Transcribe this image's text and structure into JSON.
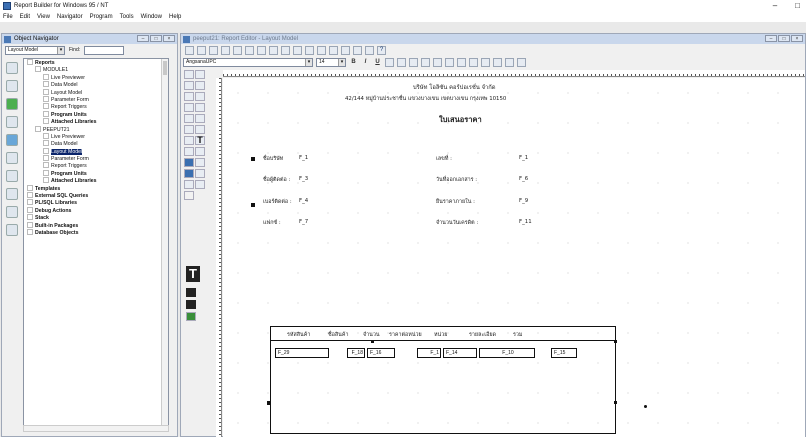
{
  "app": {
    "title": "Report Builder for Windows 95 / NT",
    "window_controls": [
      "–",
      "□"
    ]
  },
  "menu": [
    "File",
    "Edit",
    "View",
    "Navigator",
    "Program",
    "Tools",
    "Window",
    "Help"
  ],
  "navigator": {
    "title": "Object Navigator",
    "view_select": "Layout Model",
    "find_label": "Find:",
    "tree": [
      {
        "label": "Reports",
        "indent": 0,
        "bold": true
      },
      {
        "label": "MODULE1",
        "indent": 1
      },
      {
        "label": "Live Previewer",
        "indent": 2
      },
      {
        "label": "Data Model",
        "indent": 2
      },
      {
        "label": "Layout Model",
        "indent": 2
      },
      {
        "label": "Parameter Form",
        "indent": 2
      },
      {
        "label": "Report Triggers",
        "indent": 2
      },
      {
        "label": "Program Units",
        "indent": 2,
        "bold": true
      },
      {
        "label": "Attached Libraries",
        "indent": 2,
        "bold": true
      },
      {
        "label": "PEEPUT21",
        "indent": 1
      },
      {
        "label": "Live Previewer",
        "indent": 2
      },
      {
        "label": "Data Model",
        "indent": 2
      },
      {
        "label": "Layout Model",
        "indent": 2,
        "selected": true
      },
      {
        "label": "Parameter Form",
        "indent": 2
      },
      {
        "label": "Report Triggers",
        "indent": 2
      },
      {
        "label": "Program Units",
        "indent": 2,
        "bold": true
      },
      {
        "label": "Attached Libraries",
        "indent": 2,
        "bold": true
      },
      {
        "label": "Templates",
        "indent": 0,
        "bold": true
      },
      {
        "label": "External SQL Queries",
        "indent": 0,
        "bold": true
      },
      {
        "label": "PL/SQL Libraries",
        "indent": 0,
        "bold": true
      },
      {
        "label": "Debug Actions",
        "indent": 0,
        "bold": true
      },
      {
        "label": "Stack",
        "indent": 0,
        "bold": true
      },
      {
        "label": "Built-in Packages",
        "indent": 0,
        "bold": true
      },
      {
        "label": "Database Objects",
        "indent": 0,
        "bold": true
      }
    ]
  },
  "editor": {
    "title": "peeput21: Report Editor - Layout Model",
    "font_name": "AngsanaUPC",
    "font_size": "14",
    "format_buttons": [
      "B",
      "I",
      "U"
    ]
  },
  "report": {
    "company": "บริษัท โอลิซัน คอร์ปอเรชั่น จำกัด",
    "address": "42/144 หมู่บ้านประชาชื่น แขวงบางเขน เขตบางเขน กรุงเทพ 10150",
    "doc_title": "ใบเสนอราคา",
    "left_fields": [
      {
        "label": "ชื่อบริษัท",
        "field": "F_1"
      },
      {
        "label": "ชื่อผู้ติดต่อ :",
        "field": "F_3"
      },
      {
        "label": "เบอร์ติดต่อ :",
        "field": "F_4"
      },
      {
        "label": "แฟกซ์ :",
        "field": "F_7"
      }
    ],
    "right_fields": [
      {
        "label": "เลขที่ :",
        "field": "F_1"
      },
      {
        "label": "วันที่ออกเอกสาร :",
        "field": "F_6"
      },
      {
        "label": "ยืนราคาภายใน :",
        "field": "F_9"
      },
      {
        "label": "จำนวนวันเครดิต :",
        "field": "F_11"
      }
    ],
    "columns": [
      "รหัสสินค้า",
      "ชื่อสินค้า",
      "จำนวน",
      "ราคาต่อหน่วย",
      "หน่วย",
      "รายละเอียด",
      "รวม"
    ],
    "row_fields": [
      "F_29",
      "F_18",
      "F_16",
      "F_1",
      "F_14",
      "F_10",
      "F_15"
    ]
  }
}
